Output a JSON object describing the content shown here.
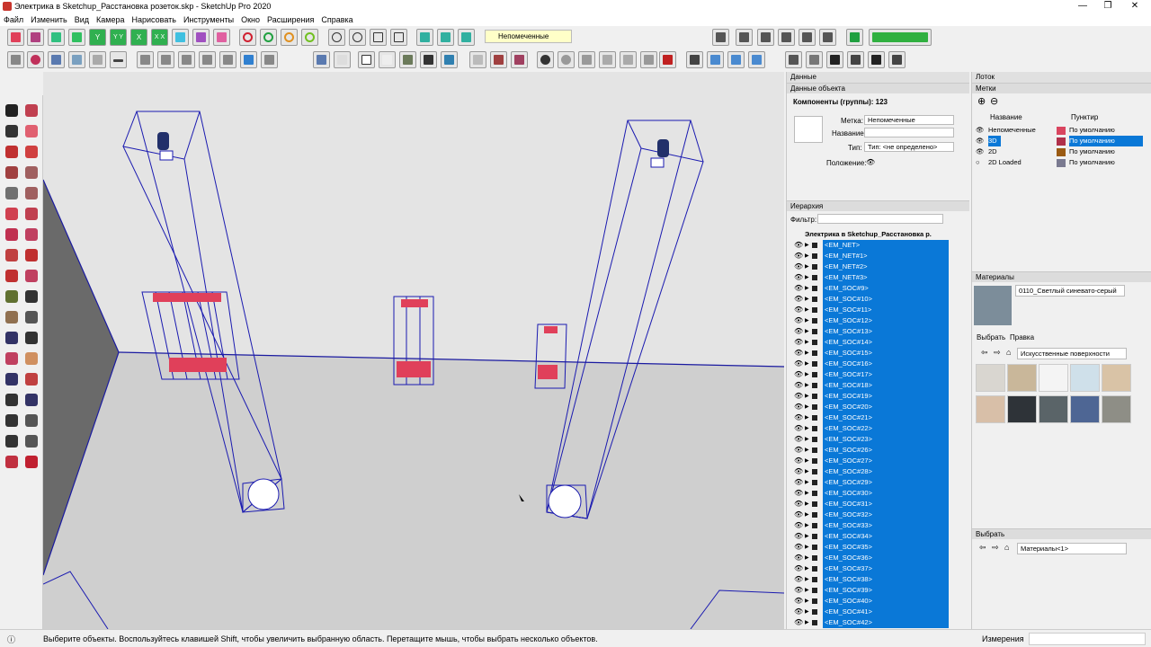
{
  "window": {
    "title": "Электрика в Sketchup_Расстановка розеток.skp - SketchUp Pro 2020",
    "minimize": "—",
    "maximize": "❐",
    "close": "✕"
  },
  "menu": [
    "Файл",
    "Изменить",
    "Вид",
    "Камера",
    "Нарисовать",
    "Инструменты",
    "Окно",
    "Расширения",
    "Справка"
  ],
  "toolbar": {
    "tag_dropdown": "Непомеченные",
    "letter_buttons": [
      "Y",
      "Y Y",
      "X",
      "X X"
    ]
  },
  "entity_panel": {
    "window_title": "Данные",
    "section_title": "Данные объекта",
    "components_label": "Компоненты (группы): 123",
    "tag_label": "Метка:",
    "tag_value": "Непомеченные",
    "name_label": "Название:",
    "name_value": "",
    "type_label": "Тип:",
    "type_value": "Тип: <не определено>",
    "position_label": "Положение:"
  },
  "outliner": {
    "section_title": "Иерархия",
    "filter_label": "Фильтр:",
    "root": "Электрика в Sketchup_Расстановка р.",
    "items": [
      "<EM_NET>",
      "<EM_NET#1>",
      "<EM_NET#2>",
      "<EM_NET#3>",
      "<EM_SOC#9>",
      "<EM_SOC#10>",
      "<EM_SOC#11>",
      "<EM_SOC#12>",
      "<EM_SOC#13>",
      "<EM_SOC#14>",
      "<EM_SOC#15>",
      "<EM_SOC#16>",
      "<EM_SOC#17>",
      "<EM_SOC#18>",
      "<EM_SOC#19>",
      "<EM_SOC#20>",
      "<EM_SOC#21>",
      "<EM_SOC#22>",
      "<EM_SOC#23>",
      "<EM_SOC#26>",
      "<EM_SOC#27>",
      "<EM_SOC#28>",
      "<EM_SOC#29>",
      "<EM_SOC#30>",
      "<EM_SOC#31>",
      "<EM_SOC#32>",
      "<EM_SOC#33>",
      "<EM_SOC#34>",
      "<EM_SOC#35>",
      "<EM_SOC#36>",
      "<EM_SOC#37>",
      "<EM_SOC#38>",
      "<EM_SOC#39>",
      "<EM_SOC#40>",
      "<EM_SOC#41>",
      "<EM_SOC#42>"
    ]
  },
  "tray": {
    "title": "Лоток",
    "tags_section": "Метки",
    "col_name": "Название",
    "col_dash": "Пунктир",
    "tags": [
      {
        "name": "Непомеченные",
        "color": "#d9455f",
        "style": "По умолчанию"
      },
      {
        "name": "3D",
        "color": "#b0304a",
        "style": "По умолчанию"
      },
      {
        "name": "2D",
        "color": "#9a5a12",
        "style": "По умолчанию"
      },
      {
        "name": "2D Loaded",
        "color": "#7a7a90",
        "style": "По умолчанию"
      }
    ],
    "materials_section": "Материалы",
    "material_name": "0110_Светлый синевато-серый",
    "material_color": "#7c8d9a",
    "tab_select": "Выбрать",
    "tab_edit": "Правка",
    "library": "Искусственные поверхности",
    "swatches": [
      "#d9d6d0",
      "#c9b79a",
      "#f4f4f4",
      "#cfe0ea",
      "#d9c3a6",
      "#d8bfa8",
      "#2e3338",
      "#5a6468",
      "#4e6694",
      "#8e8e86"
    ],
    "select_section": "Выбрать",
    "select_value": "Материалы<1>"
  },
  "status": {
    "hint": "Выберите объекты. Воспользуйтесь клавишей Shift, чтобы увеличить выбранную область. Перетащите мышь, чтобы выбрать несколько объектов.",
    "measure_label": "Измерения"
  }
}
